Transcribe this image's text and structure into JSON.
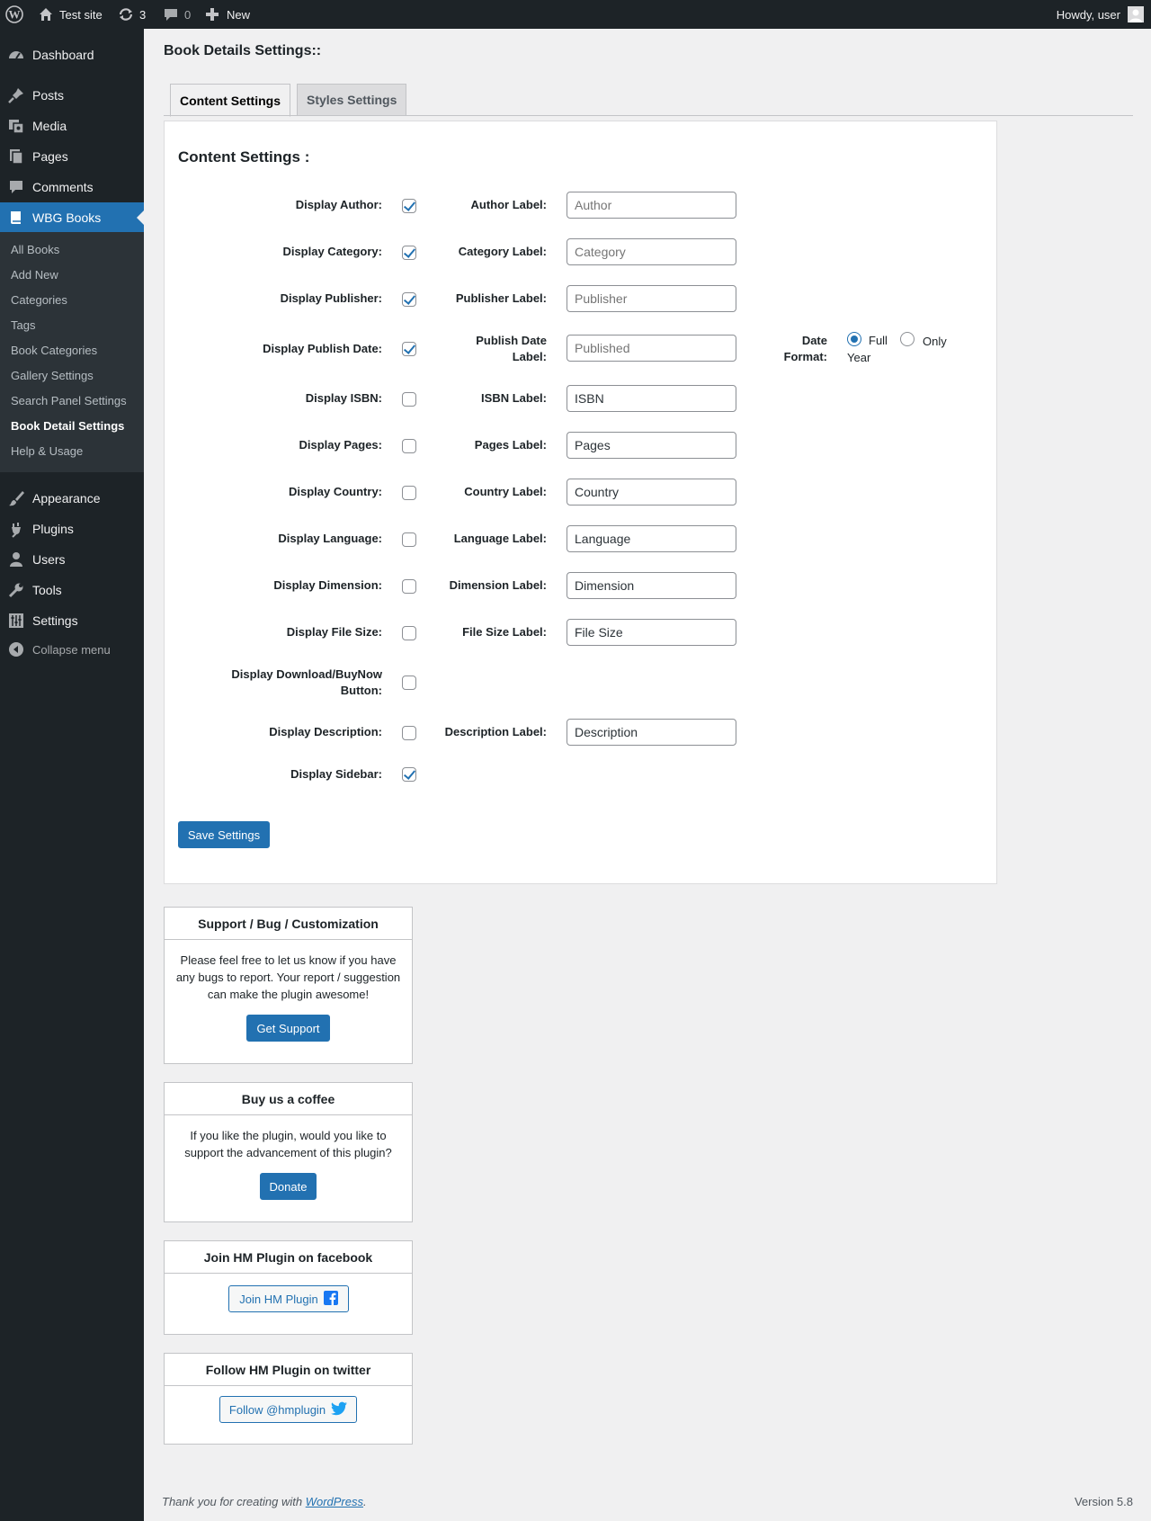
{
  "adminbar": {
    "site_name": "Test site",
    "updates_count": "3",
    "comments_count": "0",
    "new_label": "New",
    "howdy": "Howdy, user"
  },
  "sidebar": {
    "items": [
      {
        "label": "Dashboard",
        "icon": "dashboard-icon"
      },
      {
        "label": "Posts",
        "icon": "pin-icon"
      },
      {
        "label": "Media",
        "icon": "media-icon"
      },
      {
        "label": "Pages",
        "icon": "pages-icon"
      },
      {
        "label": "Comments",
        "icon": "comment-icon"
      },
      {
        "label": "WBG Books",
        "icon": "book-icon"
      },
      {
        "label": "Appearance",
        "icon": "brush-icon"
      },
      {
        "label": "Plugins",
        "icon": "plugin-icon"
      },
      {
        "label": "Users",
        "icon": "user-icon"
      },
      {
        "label": "Tools",
        "icon": "wrench-icon"
      },
      {
        "label": "Settings",
        "icon": "sliders-icon"
      }
    ],
    "submenu": [
      "All Books",
      "Add New",
      "Categories",
      "Tags",
      "Book Categories",
      "Gallery Settings",
      "Search Panel Settings",
      "Book Detail Settings",
      "Help & Usage"
    ],
    "collapse_label": "Collapse menu"
  },
  "page": {
    "title": "Book Details Settings::",
    "tabs": [
      "Content Settings",
      "Styles Settings"
    ],
    "section_title": "Content Settings :"
  },
  "settings": {
    "rows": [
      {
        "label": "Display Author:",
        "checked": true,
        "field_label": "Author Label:",
        "value": "Author",
        "is_placeholder": true
      },
      {
        "label": "Display Category:",
        "checked": true,
        "field_label": "Category Label:",
        "value": "Category",
        "is_placeholder": true
      },
      {
        "label": "Display Publisher:",
        "checked": true,
        "field_label": "Publisher Label:",
        "value": "Publisher",
        "is_placeholder": true
      },
      {
        "label": "Display Publish Date:",
        "checked": true,
        "field_label": "Publish Date Label:",
        "value": "Published",
        "is_placeholder": true
      },
      {
        "label": "Display ISBN:",
        "checked": false,
        "field_label": "ISBN Label:",
        "value": "ISBN",
        "is_placeholder": false
      },
      {
        "label": "Display Pages:",
        "checked": false,
        "field_label": "Pages Label:",
        "value": "Pages",
        "is_placeholder": false
      },
      {
        "label": "Display Country:",
        "checked": false,
        "field_label": "Country Label:",
        "value": "Country",
        "is_placeholder": false
      },
      {
        "label": "Display Language:",
        "checked": false,
        "field_label": "Language Label:",
        "value": "Language",
        "is_placeholder": false
      },
      {
        "label": "Display Dimension:",
        "checked": false,
        "field_label": "Dimension Label:",
        "value": "Dimension",
        "is_placeholder": false
      },
      {
        "label": "Display File Size:",
        "checked": false,
        "field_label": "File Size Label:",
        "value": "File Size",
        "is_placeholder": false
      },
      {
        "label": "Display Download/BuyNow Button:",
        "checked": false
      },
      {
        "label": "Display Description:",
        "checked": false,
        "field_label": "Description Label:",
        "value": "Description",
        "is_placeholder": false
      },
      {
        "label": "Display Sidebar:",
        "checked": true
      }
    ],
    "date_format": {
      "label": "Date Format:",
      "options": [
        "Full",
        "Only Year"
      ],
      "selected": "Full"
    },
    "save_label": "Save Settings"
  },
  "boxes": {
    "support": {
      "title": "Support / Bug / Customization",
      "text": "Please feel free to let us know if you have any bugs to report. Your report / suggestion can make the plugin awesome!",
      "button": "Get Support"
    },
    "coffee": {
      "title": "Buy us a coffee",
      "text": "If you like the plugin, would you like to support the advancement of this plugin?",
      "button": "Donate"
    },
    "facebook": {
      "title": "Join HM Plugin on facebook",
      "button": "Join HM Plugin"
    },
    "twitter": {
      "title": "Follow HM Plugin on twitter",
      "button": "Follow @hmplugin"
    }
  },
  "footer": {
    "thanks_prefix": "Thank you for creating with ",
    "link_text": "WordPress",
    "thanks_suffix": ".",
    "version": "Version 5.8"
  },
  "colors": {
    "accent": "#2271b1",
    "adminbar": "#1d2327",
    "submenu_bg": "#2c3338",
    "twitter": "#1da1f2",
    "facebook": "#1877f2"
  }
}
